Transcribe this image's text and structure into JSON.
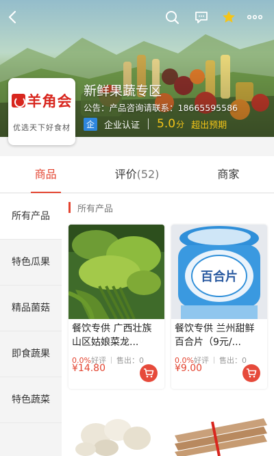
{
  "header": {
    "icons": {
      "back": "chevron-left-icon",
      "search": "search-icon",
      "message": "message-icon",
      "favorite": "star-icon",
      "more": "more-icon"
    }
  },
  "shop": {
    "logo_text": "羊角会",
    "logo_slogan": "优选天下好食材",
    "name": "新鲜果蔬专区",
    "notice": "公告：产品咨询请联系：18665595586",
    "cert_badge": "企",
    "cert_label": "企业认证",
    "score": "5.0",
    "score_unit": "分",
    "score_note": "超出预期"
  },
  "tabs": [
    {
      "label": "商品",
      "count": ""
    },
    {
      "label": "评价",
      "count": "(52)"
    },
    {
      "label": "商家",
      "count": ""
    }
  ],
  "sidebar": {
    "items": [
      {
        "label": "所有产品"
      },
      {
        "label": "特色瓜果"
      },
      {
        "label": "精品菌菇"
      },
      {
        "label": "即食蔬果"
      },
      {
        "label": "特色蔬菜"
      }
    ]
  },
  "category_title": "所有产品",
  "products": [
    {
      "title": "餐饮专供 广西壮族山区姑娘菜龙...",
      "rating": "0.0%",
      "rating_label": "好评",
      "sold_label": "售出：",
      "sold": "0",
      "price": "¥14.80"
    },
    {
      "title": "餐饮专供 兰州甜鲜百合片（9元/...",
      "rating": "0.0%",
      "rating_label": "好评",
      "sold_label": "售出：",
      "sold": "0",
      "price": "¥9.00"
    }
  ],
  "colors": {
    "accent": "#e3432f",
    "score": "#f5c518",
    "cert": "#2e86de"
  }
}
